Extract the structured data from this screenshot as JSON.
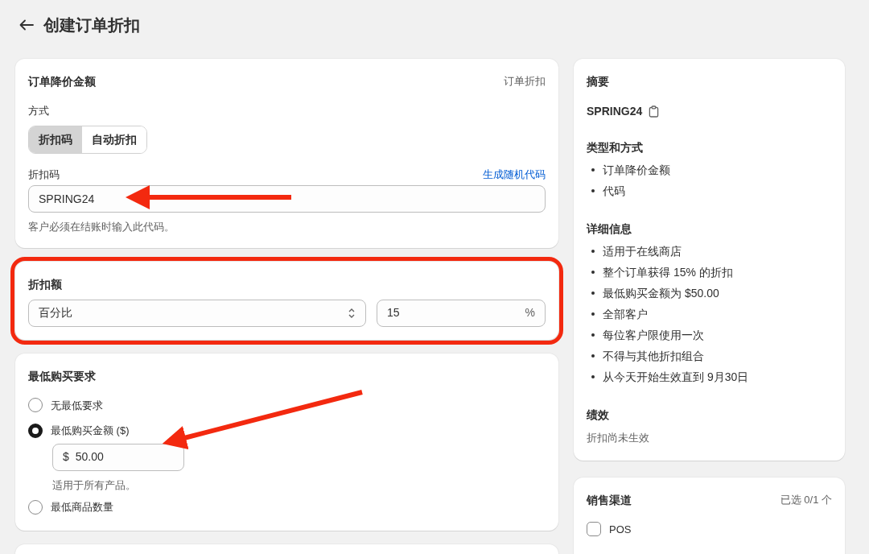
{
  "page": {
    "title": "创建订单折扣"
  },
  "discount_card": {
    "title": "订单降价金额",
    "type_label": "订单折扣",
    "method_label": "方式",
    "methods": [
      {
        "label": "折扣码",
        "selected": true
      },
      {
        "label": "自动折扣",
        "selected": false
      }
    ],
    "code_label": "折扣码",
    "generate_link": "生成随机代码",
    "code_value": "SPRING24",
    "code_help": "客户必须在结账时输入此代码。"
  },
  "amount_card": {
    "title": "折扣额",
    "highlighted": true,
    "value_type": "百分比",
    "value": "15",
    "suffix": "%"
  },
  "minimum_card": {
    "title": "最低购买要求",
    "options": [
      {
        "label": "无最低要求",
        "selected": false
      },
      {
        "label": "最低购买金额 ($)",
        "selected": true,
        "prefix": "$",
        "value": "50.00",
        "help": "适用于所有产品。"
      },
      {
        "label": "最低商品数量",
        "selected": false
      }
    ]
  },
  "summary": {
    "title": "摘要",
    "code": "SPRING24",
    "sections": [
      {
        "title": "类型和方式",
        "items": [
          "订单降价金额",
          "代码"
        ]
      },
      {
        "title": "详细信息",
        "items": [
          "适用于在线商店",
          "整个订单获得 15% 的折扣",
          "最低购买金额为 $50.00",
          "全部客户",
          "每位客户限使用一次",
          "不得与其他折扣组合",
          "从今天开始生效直到 9月30日"
        ]
      }
    ],
    "performance_title": "绩效",
    "performance_text": "折扣尚未生效"
  },
  "sales_channels": {
    "title": "销售渠道",
    "count": "已选 0/1 个",
    "channels": [
      {
        "label": "POS",
        "checked": false
      }
    ]
  }
}
